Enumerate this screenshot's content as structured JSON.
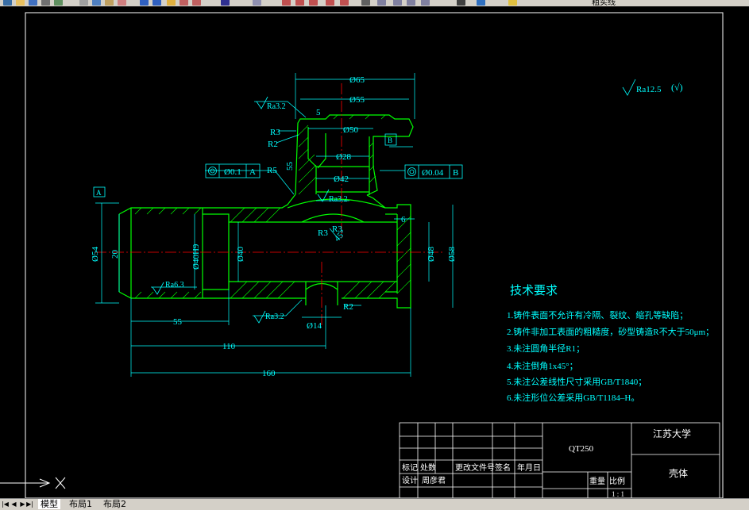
{
  "toolbar": {
    "label": "粗实线",
    "icons": [
      "new-icon",
      "open-icon",
      "save-icon",
      "print-icon",
      "preview-icon",
      "cut-icon",
      "copy-icon",
      "paste-icon",
      "match-icon",
      "undo-icon",
      "redo-icon",
      "pan-icon",
      "zoom-realtime-icon",
      "zoom-window-icon",
      "zoom-previous-icon",
      "text-style-icon",
      "dim-style-icon",
      "table-icon",
      "properties-icon",
      "design-center-icon",
      "tool-palette-icon",
      "calc-icon",
      "help-icon",
      "layer-icon",
      "layer-state-icon",
      "bulb-icon",
      "sun-icon",
      "lock-icon",
      "color-icon"
    ]
  },
  "drawing": {
    "dims": {
      "d65": "Ø65",
      "d55": "Ø55",
      "d50": "Ø50",
      "d28": "Ø28",
      "d42": "Ø42",
      "d54": "Ø54",
      "d20": "20",
      "d40h9": "Ø40H9",
      "d40": "Ø40",
      "d48": "Ø48",
      "d58": "Ø58",
      "d14": "Ø14",
      "d6": "6",
      "d5": "5",
      "r55": "55",
      "len55": "55",
      "len110": "110",
      "len160": "160"
    },
    "radii": {
      "r3a": "R3",
      "r2a": "R2",
      "r5": "R5",
      "r3b": "R3",
      "r3c": "R3",
      "r2b": "R2",
      "ang": "45°"
    },
    "roughness": {
      "ra32_top": "Ra3.2",
      "ra32_mid": "Ra3.2",
      "ra32_bot": "Ra3.2",
      "ra63": "Ra6.3",
      "ra125": "Ra12.5",
      "ra125_paren": "(√)"
    },
    "tolerances": {
      "fcf1_tol": "Ø0.1",
      "fcf1_datum": "A",
      "fcf2_tol": "Ø0.04",
      "fcf2_datum": "B",
      "datum_a": "A",
      "datum_b": "B"
    },
    "tech_title": "技术要求",
    "tech_items": [
      "1.铸件表面不允许有冷隔、裂纹、缩孔等缺陷；",
      "2.铸件非加工表面的粗糙度，砂型铸造R不大于50μm；",
      "3.未注圆角半径R1；",
      "4.未注倒角1x45°；",
      "5.未注公差线性尺寸采用GB/T1840；",
      "6.未注形位公差采用GB/T1184–H。"
    ],
    "title_block": {
      "material": "QT250",
      "school": "江苏大学",
      "part": "壳体",
      "h_mark": "标记",
      "h_count": "处数",
      "h_doc": "更改文件号",
      "h_sign": "签名",
      "h_date": "年月日",
      "h_design": "设计",
      "h_std": "周彦君",
      "h_weight": "重量",
      "h_scale": "比例",
      "scale_val": "1 : 1"
    }
  },
  "colors": {
    "outline": "#00ff00",
    "dims": "#00ffff",
    "center": "#ff0000",
    "text": "#00ffff",
    "frame": "#ffffff"
  },
  "tabs": {
    "nav": [
      "|◀",
      "◀",
      "▶",
      "▶|"
    ],
    "model": "模型",
    "layout1": "布局1",
    "layout2": "布局2"
  }
}
